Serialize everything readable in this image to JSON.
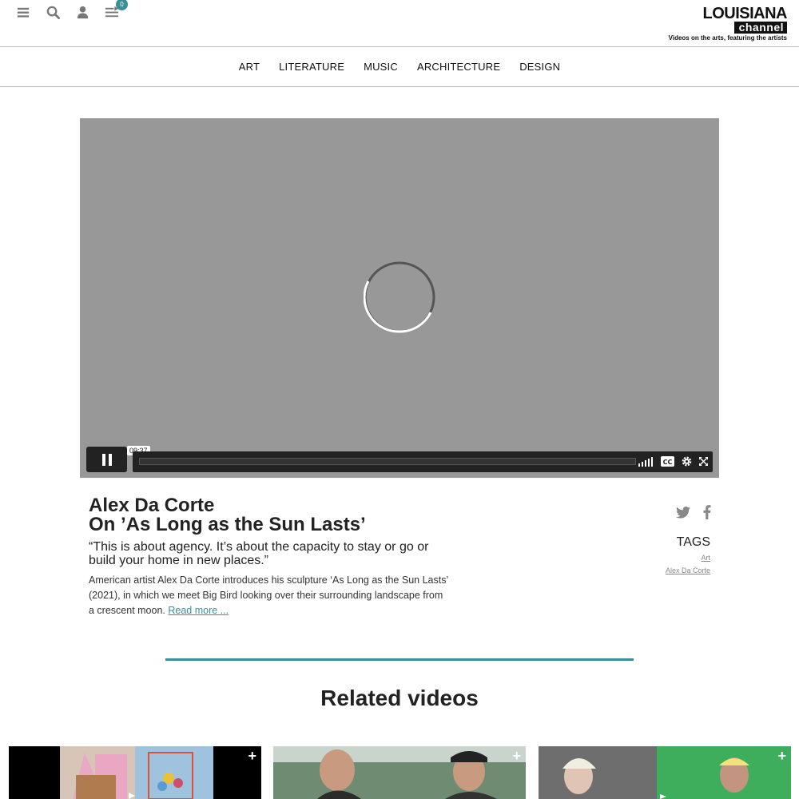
{
  "header": {
    "cart_count": "0",
    "logo_top": "LOUISIANA",
    "logo_bottom": "channel",
    "tagline": "Videos on the arts, featuring the artists",
    "icons": [
      "menu-icon",
      "search-icon",
      "user-icon",
      "playlist-icon"
    ]
  },
  "nav": {
    "items": [
      "ART",
      "LITERATURE",
      "MUSIC",
      "ARCHITECTURE",
      "DESIGN"
    ]
  },
  "video": {
    "timecode": "09:37",
    "progress": 0.0,
    "controls": [
      "pause-icon",
      "volume-icon",
      "cc-icon",
      "settings-icon",
      "fullscreen-icon"
    ]
  },
  "info": {
    "title_line1": "Alex Da Corte",
    "title_line2": "On ’As Long as the Sun Lasts’",
    "quote": "“This is about agency. It’s about the capacity to stay or go or build your home in new places.”",
    "description": "American artist Alex Da Corte introduces his sculpture ‘As Long as the Sun Lasts’ (2021), in which we meet Big Bird looking over their surrounding landscape from a crescent moon.",
    "read_more": "Read more ...",
    "tags_heading": "TAGS",
    "tags": [
      "Art",
      "Alex Da Corte"
    ]
  },
  "colors": {
    "accent": "#3a8f99",
    "video_bg": "#989898"
  },
  "related": {
    "heading": "Related videos",
    "plus": "+"
  }
}
